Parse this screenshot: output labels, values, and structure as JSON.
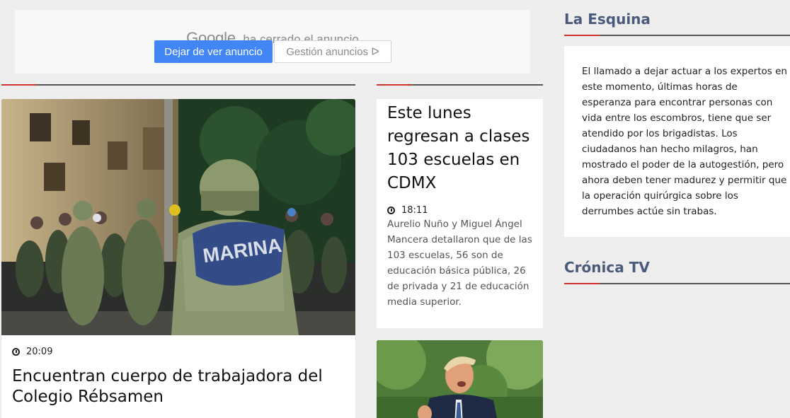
{
  "ad": {
    "brand": "Google",
    "closed_text": "ha cerrado el anuncio",
    "stop_button": "Dejar de ver anuncio",
    "manage_button": "Gestión anuncios ᐅ"
  },
  "main_story": {
    "time": "20:09",
    "title": "Encuentran cuerpo de trabajadora del Colegio Rébsamen",
    "photo_text": "MARINA"
  },
  "second_story": {
    "title": "Este lunes regresan a clases 103 escuelas en CDMX",
    "time": "18:11",
    "description": "Aurelio Nuño y Miguel Ángel Mancera detallaron que de las 103 escuelas, 56 son de educación básica pública, 26 de privada y 21 de educación media superior."
  },
  "sidebar": {
    "esquina_heading": "La Esquina",
    "esquina_text": "El llamado a dejar actuar a los expertos en este momento, últimas horas de esperanza para encontrar personas con vida entre los escombros, tiene que ser atendido por los brigadistas. Los ciudadanos han hecho milagros, han mostrado el poder de la autogestión, pero ahora deben tener madurez y permitir que la operación quirúrgica sobre los derrumbes actúe sin trabas.",
    "tv_heading": "Crónica TV"
  },
  "colors": {
    "accent": "#d0312d",
    "heading": "#4a5a7a",
    "ad_button": "#4285f4"
  }
}
